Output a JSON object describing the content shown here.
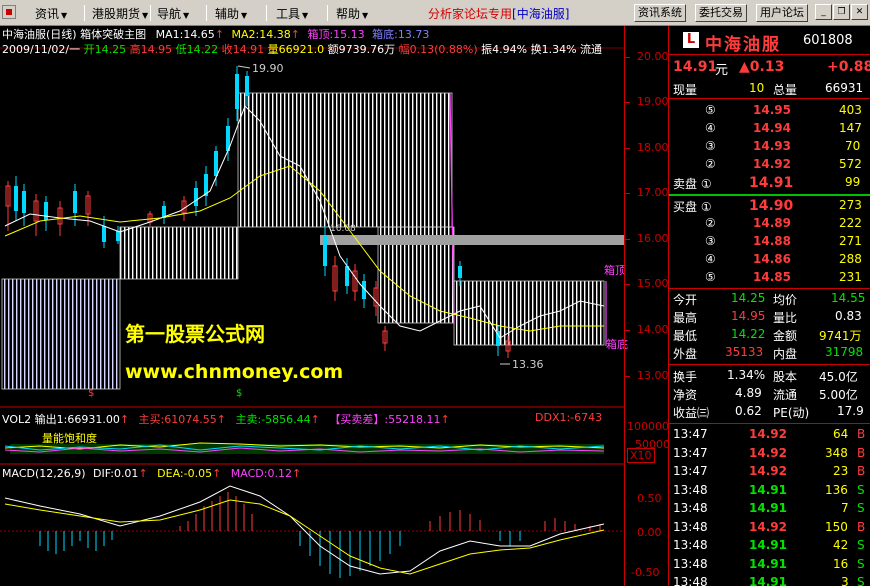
{
  "menu": {
    "items": [
      "资讯",
      "港股期货",
      "导航",
      "辅助",
      "工具",
      "帮助"
    ],
    "banner_left": "分析家论坛专用",
    "banner_right": "[中海油服]",
    "buttons": [
      "资讯系统",
      "委托交易",
      "用户论坛"
    ]
  },
  "chart": {
    "title": "中海油服(日线)",
    "indicator_name": "箱体突破主图",
    "ma1": "MA1:14.65",
    "ma2": "MA2:14.38",
    "box_top": "箱顶:15.13",
    "box_bottom": "箱底:13.73",
    "date": "2009/11/02/一",
    "open": "开14.25",
    "high": "高14.95",
    "low": "低14.22",
    "close": "收14.91",
    "volume": "量66921.0",
    "amount": "额9739.76万",
    "change": "幅0.13(0.88%)",
    "amplitude": "振4.94%",
    "turnover": "换1.34%",
    "flow": "流通",
    "high_mark": "19.90",
    "low_mark": "13.36",
    "box_label_1": "箱顶",
    "box_label_2": "箱底",
    "grey_label": "16.08",
    "watermark_1": "第一股票公式网",
    "watermark_2": "www.chnmoney.com",
    "price_labels": [
      "20.00",
      "19.00",
      "18.00",
      "17.00",
      "16.00",
      "15.00",
      "14.00",
      "13.00"
    ],
    "vol_axis": [
      "100000",
      "50000"
    ],
    "vol_multiplier": "X10",
    "macd_axis": [
      "0.50",
      "0.00",
      "-0.50"
    ]
  },
  "volume_panel": {
    "name": "VOL2",
    "output": "输出1:66931.00",
    "main_buy": "主买:61074.55",
    "main_sell": "主卖:-5856.44",
    "buy_sell_diff_label": "【买卖差】",
    "buy_sell_diff": ":55218.11",
    "ddx": "DDX1:-6743",
    "saturation": "量能饱和度"
  },
  "macd_panel": {
    "name": "MACD(12,26,9)",
    "dif": "DIF:0.01",
    "dea": "DEA:-0.05",
    "macd": "MACD:0.12"
  },
  "stock": {
    "name": "中海油服",
    "code": "601808",
    "price": "14.91",
    "unit": "元",
    "change": "▲0.13",
    "change_pct": "+0.88",
    "current_vol_label": "现量",
    "current_vol": "10",
    "total_vol_label": "总量",
    "total_vol": "66931"
  },
  "order_book": {
    "sell": [
      {
        "label": "⑤",
        "price": "14.95",
        "vol": "403"
      },
      {
        "label": "④",
        "price": "14.94",
        "vol": "147"
      },
      {
        "label": "③",
        "price": "14.93",
        "vol": "70"
      },
      {
        "label": "②",
        "price": "14.92",
        "vol": "572"
      },
      {
        "label": "卖盘 ①",
        "price": "14.91",
        "vol": "99"
      }
    ],
    "buy": [
      {
        "label": "买盘 ①",
        "price": "14.90",
        "vol": "273"
      },
      {
        "label": "②",
        "price": "14.89",
        "vol": "222"
      },
      {
        "label": "③",
        "price": "14.88",
        "vol": "271"
      },
      {
        "label": "④",
        "price": "14.86",
        "vol": "288"
      },
      {
        "label": "⑤",
        "price": "14.85",
        "vol": "231"
      }
    ]
  },
  "stats": [
    {
      "l1": "今开",
      "v1": "14.25",
      "l2": "均价",
      "v2": "14.55"
    },
    {
      "l1": "最高",
      "v1": "14.95",
      "l2": "量比",
      "v2": "0.83"
    },
    {
      "l1": "最低",
      "v1": "14.22",
      "l2": "金额",
      "v2": "9741万"
    },
    {
      "l1": "外盘",
      "v1": "35133",
      "l2": "内盘",
      "v2": "31798"
    }
  ],
  "stats2": [
    {
      "l1": "换手",
      "v1": "1.34%",
      "l2": "股本",
      "v2": "45.0亿"
    },
    {
      "l1": "净资",
      "v1": "4.89",
      "l2": "流通",
      "v2": "5.00亿"
    },
    {
      "l1": "收益㈢",
      "v1": "0.62",
      "l2": "PE(动)",
      "v2": "17.9"
    }
  ],
  "ticks": [
    {
      "time": "13:47",
      "price": "14.92",
      "vol": "64",
      "side": "B"
    },
    {
      "time": "13:47",
      "price": "14.92",
      "vol": "348",
      "side": "B"
    },
    {
      "time": "13:47",
      "price": "14.92",
      "vol": "23",
      "side": "B"
    },
    {
      "time": "13:48",
      "price": "14.91",
      "vol": "136",
      "side": "S"
    },
    {
      "time": "13:48",
      "price": "14.91",
      "vol": "7",
      "side": "S"
    },
    {
      "time": "13:48",
      "price": "14.92",
      "vol": "150",
      "side": "B"
    },
    {
      "time": "13:48",
      "price": "14.91",
      "vol": "42",
      "side": "S"
    },
    {
      "time": "13:48",
      "price": "14.91",
      "vol": "16",
      "side": "S"
    },
    {
      "time": "13:48",
      "price": "14.91",
      "vol": "3",
      "side": "S"
    }
  ]
}
